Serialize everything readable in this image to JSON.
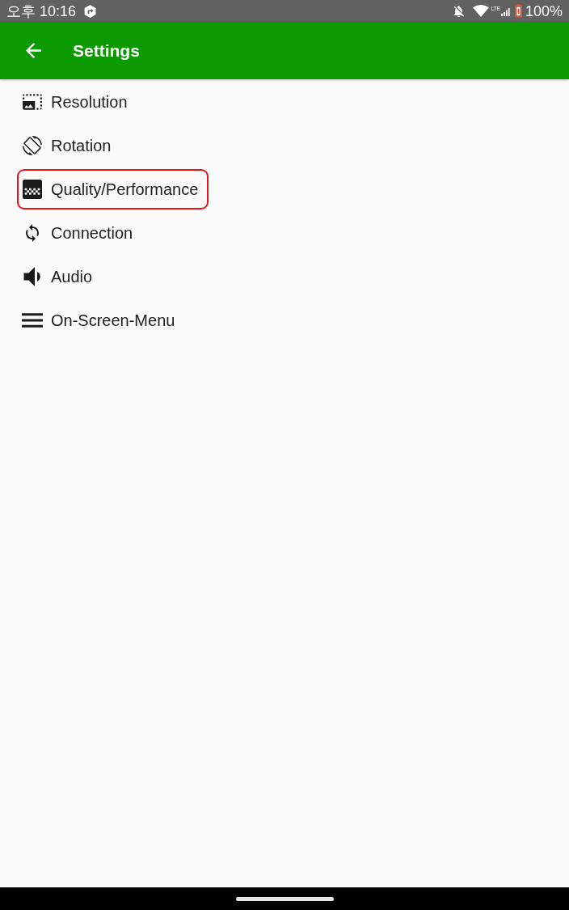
{
  "status_bar": {
    "time": "오후 10:16",
    "network": "LTE",
    "battery": "100%"
  },
  "app_bar": {
    "title": "Settings"
  },
  "settings_items": [
    {
      "label": "Resolution",
      "highlighted": false
    },
    {
      "label": "Rotation",
      "highlighted": false
    },
    {
      "label": "Quality/Performance",
      "highlighted": true
    },
    {
      "label": "Connection",
      "highlighted": false
    },
    {
      "label": "Audio",
      "highlighted": false
    },
    {
      "label": "On-Screen-Menu",
      "highlighted": false
    }
  ]
}
